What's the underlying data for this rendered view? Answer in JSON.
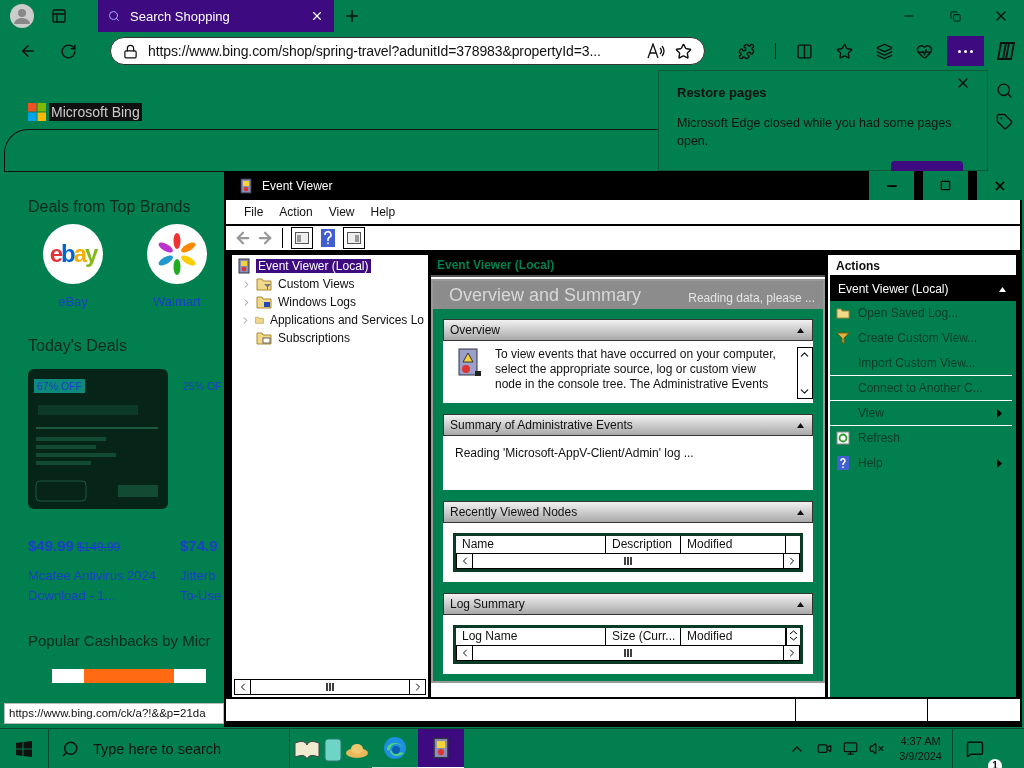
{
  "browser": {
    "tab": {
      "title": "Search Shopping"
    },
    "url": "https://www.bing.com/shop/spring-travel?adunitId=378983&propertyId=3...",
    "page": {
      "logo": "Microsoft Bing",
      "brands_heading": "Deals from Top Brands",
      "brands": [
        {
          "name": "eBay",
          "kind": "ebay",
          "logo_text": "ebay"
        },
        {
          "name": "Walmart",
          "kind": "walmart"
        }
      ],
      "deals_heading": "Today's Deals",
      "deals": [
        {
          "badge": "67% OFF",
          "price": "$49.99",
          "old_price": "$149.99",
          "title": "Mcafee Antivirus 2024 Download - 1...",
          "kind": "picture"
        },
        {
          "badge": "25% OF",
          "price": "$74.9",
          "title": "Jitterb To-Use"
        }
      ],
      "cashback_heading": "Popular Cashbacks by Micr"
    },
    "restore_panel": {
      "title": "Restore pages",
      "message": "Microsoft Edge closed while you had some pages open."
    },
    "status_url": "https://www.bing.com/ck/a?!&&p=21da"
  },
  "event_viewer": {
    "title": "Event Viewer",
    "menu": [
      "File",
      "Action",
      "View",
      "Help"
    ],
    "tree": [
      {
        "label": "Event Viewer (Local)",
        "selected": true,
        "children": [
          {
            "label": "Custom Views",
            "selected": false,
            "expandable": true
          },
          {
            "label": "Windows Logs",
            "selected": false,
            "expandable": true
          },
          {
            "label": "Applications and Services Lo",
            "selected": false,
            "expandable": true
          },
          {
            "label": "Subscriptions",
            "selected": false,
            "expandable": false
          }
        ]
      }
    ],
    "pane_header": "Event Viewer (Local)",
    "summary": {
      "title": "Overview and Summary",
      "status": "Reading data, please ..."
    },
    "sections": [
      {
        "title": "Overview",
        "expanded": true,
        "kind": "info",
        "text": "To view events that have occurred on your computer, select the appropriate source, log or custom view node in the console tree. The Administrative Events"
      },
      {
        "title": "Summary of Administrative Events",
        "expanded": true,
        "kind": "text",
        "text": "Reading 'Microsoft-AppV-Client/Admin' log ..."
      },
      {
        "title": "Recently Viewed Nodes",
        "expanded": true,
        "kind": "table",
        "columns": [
          "Name",
          "Description",
          "Modified"
        ]
      },
      {
        "title": "Log Summary",
        "expanded": true,
        "kind": "table",
        "columns": [
          "Log Name",
          "Size (Curr...",
          "Modified"
        ]
      }
    ],
    "actions": {
      "title": "Actions",
      "group": "Event Viewer (Local)",
      "group_expanded": true,
      "items": [
        {
          "label": "Open Saved Log...",
          "submenu": false,
          "divider": false
        },
        {
          "label": "Create Custom View...",
          "submenu": false,
          "divider": false
        },
        {
          "label": "Import Custom View...",
          "submenu": false,
          "divider": true
        },
        {
          "label": "Connect to Another C...",
          "submenu": false,
          "divider": true
        },
        {
          "label": "View",
          "submenu": true,
          "divider": true
        },
        {
          "label": "Refresh",
          "submenu": false,
          "divider": false
        },
        {
          "label": "Help",
          "submenu": true,
          "divider": false
        }
      ]
    }
  },
  "taskbar": {
    "search_placeholder": "Type here to search",
    "apps": [
      {
        "kind": "edge",
        "selected": false
      },
      {
        "kind": "event_viewer",
        "selected": true
      }
    ],
    "time": "4:37 AM",
    "date": "3/9/2024",
    "notifications": "1"
  }
}
